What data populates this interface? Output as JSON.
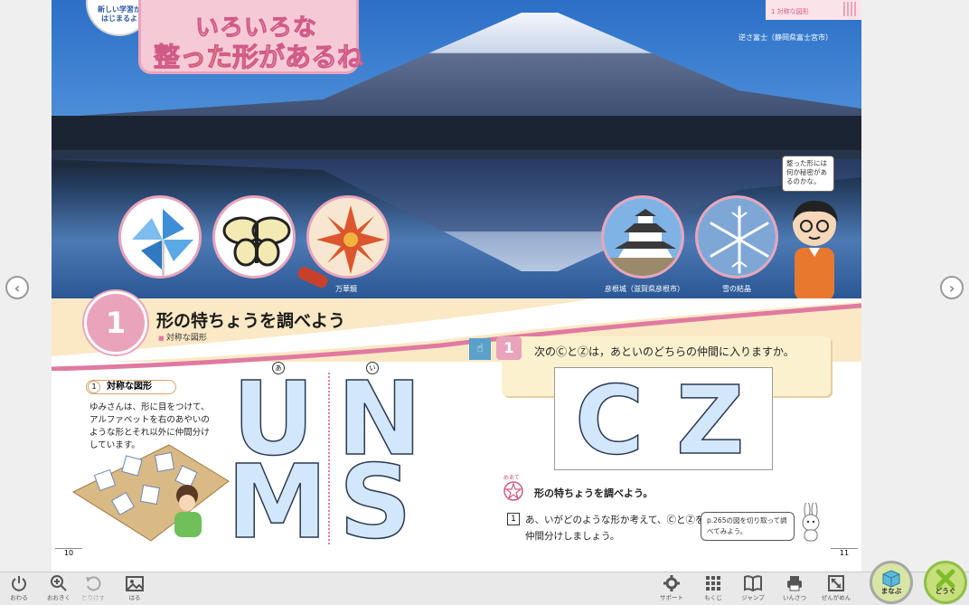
{
  "hero": {
    "badge_new_line1": "新しい学習が",
    "badge_new_line2": "はじまるよ",
    "title_line1": "いろいろな",
    "title_line2_highlight": "整った形",
    "title_line2_rest": "があるね",
    "header_tag": "1 対称な図形",
    "caption_fuji": "逆さ富士（静岡県富士宮市）",
    "caption_kaleidoscope": "万華鏡",
    "caption_castle": "彦根城（滋賀県彦根市）",
    "caption_snow": "雪の結晶",
    "speech": "整った形には何か秘密があるのかな。"
  },
  "section": {
    "number": "1",
    "title": "形の特ちょうを調べよう",
    "subtitle": "対称な図形"
  },
  "left_page": {
    "q_tag_num": "1",
    "q_tag_label": "対称な図形",
    "text": "ゆみさんは、形に目をつけて、アルファベットを右のあやいのような形とそれ以外に仲間分けしています。",
    "group_a_label": "あ",
    "group_b_label": "い",
    "letters_a": [
      "U",
      "M"
    ],
    "letters_b": [
      "N",
      "S"
    ],
    "page_number": "10"
  },
  "right_page": {
    "q_number": "1",
    "q_text": "次のⒸとⓏは，あといのどちらの仲間に入りますか。",
    "card_letters": [
      "C",
      "Z"
    ],
    "goal_label": "めあて",
    "goal_text": "形の特ちょうを調べよう。",
    "step_num": "1",
    "step_text": "あ、いがどのような形か考えて、ⒸとⓏを仲間分けしましょう。",
    "hint": "p.265の図を切り取って調べてみよう。",
    "page_number": "11"
  },
  "toolbar": {
    "quit": "おわる",
    "zoom": "おおきく",
    "undo": "とりけす",
    "paste": "はる",
    "support": "サポート",
    "toc": "もくじ",
    "jump": "ジャンプ",
    "print": "いんさつ",
    "fullscreen": "ぜんがめん",
    "manabu": "まなぶ",
    "dougu": "どうぐ"
  },
  "colors": {
    "accent_pink": "#e9a4bb",
    "band_cream": "#fbe9c6",
    "letter_fill": "#d3e7fb"
  }
}
